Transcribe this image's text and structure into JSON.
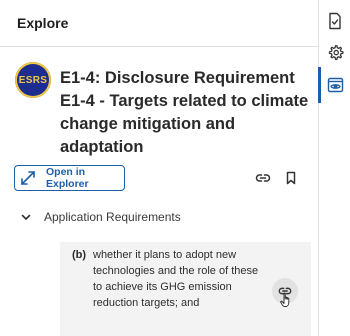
{
  "panel": {
    "title": "Explore"
  },
  "standard": {
    "badge": "ESRS",
    "heading": "E1-4: Disclosure Requirement E1-4 - Targets related to climate change mitigation and adaptation"
  },
  "actions": {
    "open_label": "Open in Explorer"
  },
  "section": {
    "label": "Application Requirements"
  },
  "requirement": {
    "letter": "(b)",
    "text": "whether it plans to adopt new technologies and the role of these to achieve its GHG emission reduction targets; and"
  },
  "colors": {
    "accent": "#1d5ea8",
    "badge_bg": "#1d2d8f",
    "badge_fg": "#f2c744"
  }
}
